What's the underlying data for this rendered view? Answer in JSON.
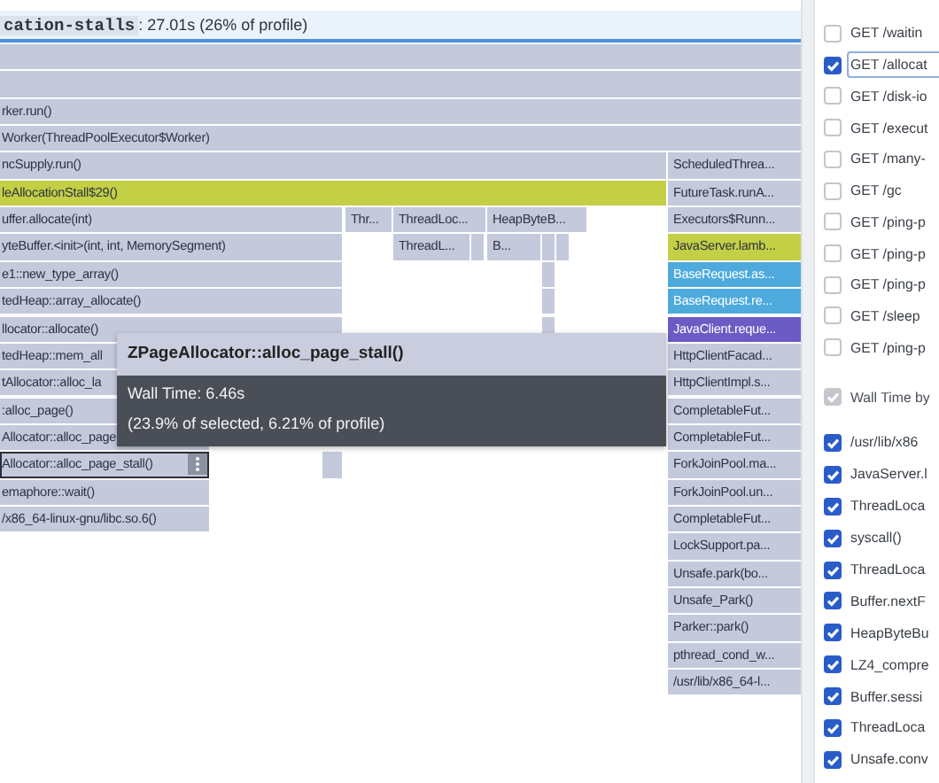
{
  "header": {
    "name": "cation-stalls",
    "summary": ": 27.01s (26% of profile)"
  },
  "flame_rows": [
    {
      "frames": [
        {
          "color": "#c5c9dc",
          "selected": false
        }
      ]
    },
    {
      "frames": [
        {
          "color": "#c5c9dc",
          "selected": false
        }
      ]
    },
    {
      "frames": [
        {
          "label": "rker.run()",
          "color": "#c5c9dc",
          "selected": false
        }
      ]
    },
    {
      "frames": [
        {
          "label": "Worker(ThreadPoolExecutor$Worker)",
          "color": "#c5c9dc",
          "selected": false
        }
      ]
    },
    {
      "frames": [
        {
          "label": "ncSupply.run()",
          "color": "#c5c9dc",
          "selected": false
        },
        {
          "label": "ScheduledThrea...",
          "color": "#c5c9dc",
          "selected": false
        }
      ]
    },
    {
      "frames": [
        {
          "label": "leAllocationStall$29()",
          "color": "#c3cf45",
          "selected": false
        },
        {
          "label": "FutureTask.runA...",
          "color": "#c5c9dc",
          "selected": false
        }
      ]
    },
    {
      "frames": [
        {
          "label": "uffer.allocate(int)",
          "color": "#c5c9dc",
          "selected": false
        },
        {
          "label": "Thr...",
          "color": "#c5c9dc",
          "selected": false
        },
        {
          "label": "ThreadLoc...",
          "color": "#c5c9dc",
          "selected": false
        },
        {
          "label": "HeapByteB...",
          "color": "#c5c9dc",
          "selected": false
        },
        {
          "label": "Executors$Runn...",
          "color": "#c5c9dc",
          "selected": false
        }
      ]
    },
    {
      "frames": [
        {
          "label": "yteBuffer.<init>(int, int, MemorySegment)",
          "color": "#c5c9dc",
          "selected": false
        },
        {
          "label": "ThreadL...",
          "color": "#c5c9dc",
          "selected": false
        },
        {
          "color": "#c5c9dc",
          "selected": false
        },
        {
          "label": "B...",
          "color": "#c5c9dc",
          "selected": false
        },
        {
          "color": "#c5c9dc",
          "selected": false
        },
        {
          "color": "#c5c9dc",
          "selected": false
        },
        {
          "label": "JavaServer.lamb...",
          "color": "#c3cf45",
          "selected": false
        }
      ]
    },
    {
      "frames": [
        {
          "label": "e1::new_type_array()",
          "color": "#c5c9dc",
          "selected": false
        },
        {
          "color": "#c5c9dc",
          "selected": false
        },
        {
          "label": "BaseRequest.as...",
          "color": "#4eaadd",
          "selected": false
        }
      ]
    },
    {
      "frames": [
        {
          "label": "tedHeap::array_allocate()",
          "color": "#c5c9dc",
          "selected": false
        },
        {
          "color": "#c5c9dc",
          "selected": false
        },
        {
          "label": "BaseRequest.re...",
          "color": "#4eaadd",
          "selected": false
        }
      ]
    },
    {
      "frames": [
        {
          "label": "llocator::allocate()",
          "color": "#c5c9dc",
          "selected": false
        },
        {
          "color": "#c5c9dc",
          "selected": false
        },
        {
          "label": "JavaClient.reque...",
          "color": "#6b5bc4",
          "selected": false
        }
      ]
    },
    {
      "frames": [
        {
          "label": "tedHeap::mem_all",
          "color": "#c5c9dc",
          "selected": false
        },
        {
          "label": "HttpClientFacad...",
          "color": "#c5c9dc",
          "selected": false
        }
      ]
    },
    {
      "frames": [
        {
          "label": "tAllocator::alloc_la",
          "color": "#c5c9dc",
          "selected": false
        },
        {
          "label": "HttpClientImpl.s...",
          "color": "#c5c9dc",
          "selected": false
        }
      ]
    },
    {
      "frames": [
        {
          "label": ":alloc_page()",
          "color": "#c5c9dc",
          "selected": false
        },
        {
          "label": "CompletableFut...",
          "color": "#c5c9dc",
          "selected": false
        }
      ]
    },
    {
      "frames": [
        {
          "label": "Allocator::alloc_page",
          "color": "#c5c9dc",
          "selected": false
        },
        {
          "label": "CompletableFut...",
          "color": "#c5c9dc",
          "selected": false
        }
      ]
    },
    {
      "frames": [
        {
          "label": "Allocator::alloc_page_stall()",
          "color": "#c5c9dc",
          "selected": true
        },
        {
          "color": "#c5c9dc",
          "selected": false
        },
        {
          "label": "ForkJoinPool.ma...",
          "color": "#c5c9dc",
          "selected": false
        }
      ]
    },
    {
      "frames": [
        {
          "label": "emaphore::wait()",
          "color": "#c5c9dc",
          "selected": false
        },
        {
          "label": "ForkJoinPool.un...",
          "color": "#c5c9dc",
          "selected": false
        }
      ]
    },
    {
      "frames": [
        {
          "label": "/x86_64-linux-gnu/libc.so.6()",
          "color": "#c5c9dc",
          "selected": false
        },
        {
          "label": "CompletableFut...",
          "color": "#c5c9dc",
          "selected": false
        }
      ]
    },
    {
      "frames": [
        {
          "label": "LockSupport.pa...",
          "color": "#c5c9dc",
          "selected": false
        }
      ]
    },
    {
      "frames": [
        {
          "label": "Unsafe.park(bo...",
          "color": "#c5c9dc",
          "selected": false
        }
      ]
    },
    {
      "frames": [
        {
          "label": "Unsafe_Park()",
          "color": "#c5c9dc",
          "selected": false
        }
      ]
    },
    {
      "frames": [
        {
          "label": "Parker::park()",
          "color": "#c5c9dc",
          "selected": false
        }
      ]
    },
    {
      "frames": [
        {
          "label": "pthread_cond_w...",
          "color": "#c5c9dc",
          "selected": false
        }
      ]
    },
    {
      "frames": [
        {
          "label": "/usr/lib/x86_64-l...",
          "color": "#c5c9dc",
          "selected": false
        }
      ]
    }
  ],
  "tooltip": {
    "title": "ZPageAllocator::alloc_page_stall()",
    "lines": [
      "Wall Time: 6.46s",
      "(23.9% of selected, 6.21% of profile)"
    ]
  },
  "request_filters": [
    {
      "label": "GET /waitin",
      "checked": false,
      "selected": false
    },
    {
      "label": "GET /allocat",
      "checked": true,
      "selected": true
    },
    {
      "label": "GET /disk-io",
      "checked": false,
      "selected": false
    },
    {
      "label": "GET /execut",
      "checked": false,
      "selected": false
    },
    {
      "label": "GET /many-",
      "checked": false,
      "selected": false
    },
    {
      "label": "GET /gc",
      "checked": false,
      "selected": false
    },
    {
      "label": "GET /ping-p",
      "checked": false,
      "selected": false
    },
    {
      "label": "GET /ping-p",
      "checked": false,
      "selected": false
    },
    {
      "label": "GET /ping-p",
      "checked": false,
      "selected": false
    },
    {
      "label": "GET /sleep",
      "checked": false,
      "selected": false
    },
    {
      "label": "GET /ping-p",
      "checked": false,
      "selected": false
    }
  ],
  "frame_filter_header": {
    "label": "Wall Time by",
    "checked": true,
    "disabled": true
  },
  "frame_filters": [
    {
      "label": "/usr/lib/x86",
      "checked": true
    },
    {
      "label": "JavaServer.l",
      "checked": true
    },
    {
      "label": "ThreadLoca",
      "checked": true
    },
    {
      "label": "syscall()",
      "checked": true
    },
    {
      "label": "ThreadLoca",
      "checked": true
    },
    {
      "label": "Buffer.nextF",
      "checked": true
    },
    {
      "label": "HeapByteBu",
      "checked": true
    },
    {
      "label": "LZ4_compre",
      "checked": true
    },
    {
      "label": "Buffer.sessi",
      "checked": true
    },
    {
      "label": "ThreadLoca",
      "checked": true
    },
    {
      "label": "Unsafe.conv",
      "checked": true
    }
  ]
}
